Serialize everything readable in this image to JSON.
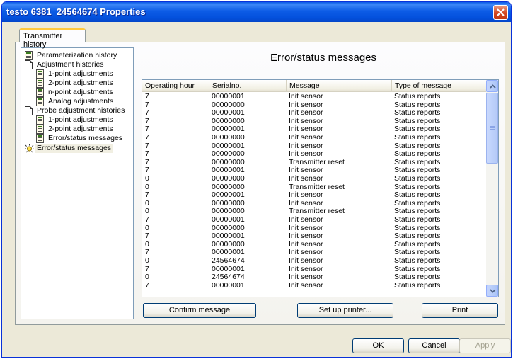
{
  "window": {
    "title": "testo 6381  24564674 Properties"
  },
  "tab": {
    "label": "Transmitter history"
  },
  "tree": [
    {
      "label": "Parameterization history",
      "icon": "document-list-icon",
      "level": 0
    },
    {
      "label": "Adjustment histories",
      "icon": "document-icon",
      "level": 0
    },
    {
      "label": "1-point adjustments",
      "icon": "document-list-icon",
      "level": 1
    },
    {
      "label": "2-point adjustments",
      "icon": "document-list-icon",
      "level": 1
    },
    {
      "label": "n-point adjustments",
      "icon": "document-list-icon",
      "level": 1
    },
    {
      "label": "Analog adjustments",
      "icon": "document-list-icon",
      "level": 1
    },
    {
      "label": "Probe adjustment histories",
      "icon": "document-icon",
      "level": 0
    },
    {
      "label": "1-point adjustments",
      "icon": "document-list-icon",
      "level": 1
    },
    {
      "label": "2-point adjustments",
      "icon": "document-list-icon",
      "level": 1
    },
    {
      "label": "Error/status messages",
      "icon": "document-list-icon",
      "level": 1
    },
    {
      "label": "Error/status messages",
      "icon": "alert-light-icon",
      "level": 0,
      "selected": true
    }
  ],
  "panel": {
    "title": "Error/status messages"
  },
  "grid": {
    "headers": [
      "Operating hour",
      "Serialno.",
      "Message",
      "Type of message"
    ],
    "rows": [
      [
        "7",
        "00000001",
        "Init sensor",
        "Status reports"
      ],
      [
        "7",
        "00000000",
        "Init sensor",
        "Status reports"
      ],
      [
        "7",
        "00000001",
        "Init sensor",
        "Status reports"
      ],
      [
        "7",
        "00000000",
        "Init sensor",
        "Status reports"
      ],
      [
        "7",
        "00000001",
        "Init sensor",
        "Status reports"
      ],
      [
        "7",
        "00000000",
        "Init sensor",
        "Status reports"
      ],
      [
        "7",
        "00000001",
        "Init sensor",
        "Status reports"
      ],
      [
        "7",
        "00000000",
        "Init sensor",
        "Status reports"
      ],
      [
        "7",
        "00000000",
        "Transmitter reset",
        "Status reports"
      ],
      [
        "7",
        "00000001",
        "Init sensor",
        "Status reports"
      ],
      [
        "0",
        "00000000",
        "Init sensor",
        "Status reports"
      ],
      [
        "0",
        "00000000",
        "Transmitter reset",
        "Status reports"
      ],
      [
        "7",
        "00000001",
        "Init sensor",
        "Status reports"
      ],
      [
        "0",
        "00000000",
        "Init sensor",
        "Status reports"
      ],
      [
        "0",
        "00000000",
        "Transmitter reset",
        "Status reports"
      ],
      [
        "7",
        "00000001",
        "Init sensor",
        "Status reports"
      ],
      [
        "0",
        "00000000",
        "Init sensor",
        "Status reports"
      ],
      [
        "7",
        "00000001",
        "Init sensor",
        "Status reports"
      ],
      [
        "0",
        "00000000",
        "Init sensor",
        "Status reports"
      ],
      [
        "7",
        "00000001",
        "Init sensor",
        "Status reports"
      ],
      [
        "0",
        "24564674",
        "Init sensor",
        "Status reports"
      ],
      [
        "7",
        "00000001",
        "Init sensor",
        "Status reports"
      ],
      [
        "0",
        "24564674",
        "Init sensor",
        "Status reports"
      ],
      [
        "7",
        "00000001",
        "Init sensor",
        "Status reports"
      ]
    ]
  },
  "actions": {
    "confirm": "Confirm message",
    "printer": "Set up printer...",
    "print": "Print"
  },
  "dialog_buttons": {
    "ok": "OK",
    "cancel": "Cancel",
    "apply": "Apply"
  },
  "colors": {
    "titlebar": "#0a5ae8",
    "close": "#d3471f",
    "tab_accent": "#ffc83c",
    "scroll": "#c3d3fd"
  }
}
